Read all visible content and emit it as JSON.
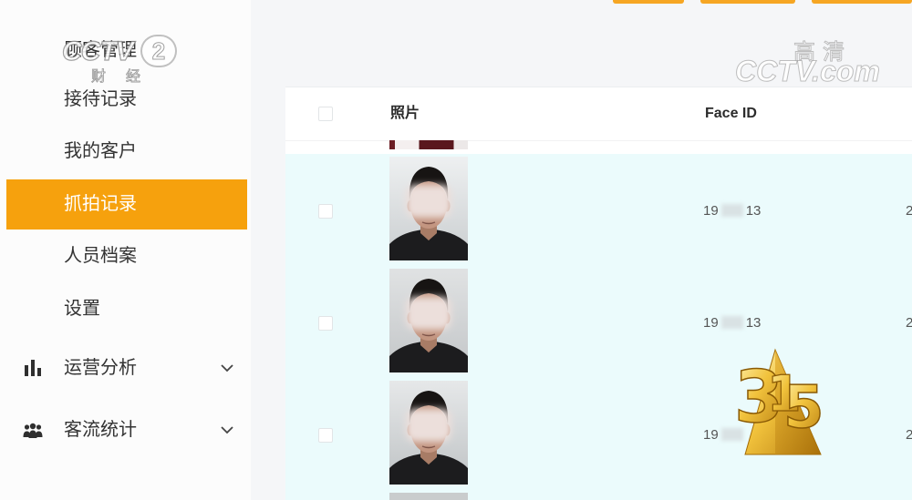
{
  "sidebar": {
    "items": [
      {
        "label": "顾客管理"
      },
      {
        "label": "接待记录"
      },
      {
        "label": "我的客户"
      },
      {
        "label": "抓拍记录",
        "active": true
      },
      {
        "label": "人员档案"
      },
      {
        "label": "设置"
      },
      {
        "label": "运营分析",
        "icon": "bar-chart-icon",
        "expand_icon": "chevron-down-icon"
      },
      {
        "label": "客流统计",
        "icon": "people-icon",
        "expand_icon": "chevron-down-icon"
      }
    ]
  },
  "table": {
    "header": {
      "photo": "照片",
      "face_id": "Face ID"
    },
    "rows": [
      {
        "face_id_start": "19",
        "face_id_end": "13",
        "next_col": "2"
      },
      {
        "face_id_start": "19",
        "face_id_end": "13",
        "next_col": "2"
      },
      {
        "face_id_start": "19",
        "next_col": "2"
      }
    ]
  },
  "overlays": {
    "channel_logo": {
      "brand": "CCTV",
      "channel": "2",
      "subtitle": "财经"
    },
    "watermark": {
      "quality": "高清",
      "site": "CCTV.com"
    },
    "logo_315": {
      "digits": [
        "3",
        "1",
        "5"
      ]
    }
  },
  "colors": {
    "accent": "#f6a10d",
    "active_text": "#ffffff",
    "row_highlight": "#ebfbfc",
    "text": "#333333"
  }
}
